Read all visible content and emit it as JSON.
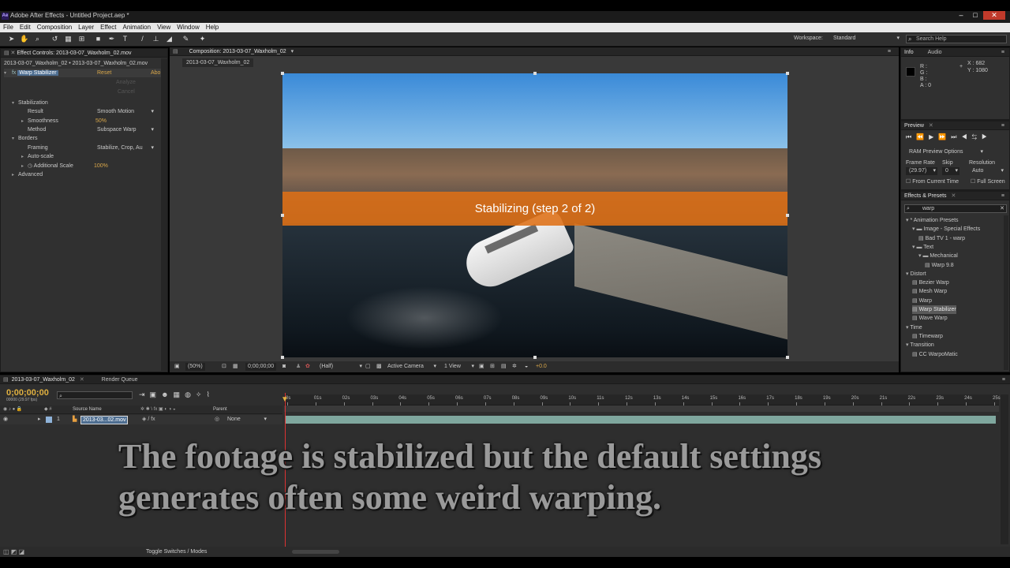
{
  "window": {
    "title": "Adobe After Effects - Untitled Project.aep *",
    "app_icon": "Ae"
  },
  "menu": [
    "File",
    "Edit",
    "Composition",
    "Layer",
    "Effect",
    "Animation",
    "View",
    "Window",
    "Help"
  ],
  "toolbar": {
    "workspace_label": "Workspace:",
    "workspace_value": "Standard",
    "search_placeholder": "Search Help"
  },
  "effect_controls": {
    "tab_label": "Effect Controls: 2013-03-07_Waxholm_02.mov",
    "layer_path": "2013-03-07_Waxholm_02 • 2013-03-07_Waxholm_02.mov",
    "effect_name": "Warp Stabilizer",
    "reset": "Reset",
    "about": "Abo",
    "analyze": "Analyze",
    "cancel": "Cancel",
    "rows": [
      {
        "label": "Stabilization",
        "indent": 0,
        "value": ""
      },
      {
        "label": "Result",
        "indent": 1,
        "value": "Smooth Motion",
        "kind": "dropdown"
      },
      {
        "label": "Smoothness",
        "indent": 1,
        "value": "50%",
        "kind": "number"
      },
      {
        "label": "Method",
        "indent": 1,
        "value": "Subspace Warp",
        "kind": "dropdown"
      },
      {
        "label": "Borders",
        "indent": 0,
        "value": ""
      },
      {
        "label": "Framing",
        "indent": 1,
        "value": "Stabilize, Crop, Au",
        "kind": "dropdown"
      },
      {
        "label": "Auto-scale",
        "indent": 1,
        "value": ""
      },
      {
        "label": "Additional Scale",
        "indent": 1,
        "value": "100%",
        "kind": "number"
      },
      {
        "label": "Advanced",
        "indent": 0,
        "value": ""
      }
    ]
  },
  "composition": {
    "tab_label": "Composition: 2013-03-07_Waxholm_02",
    "sub_tab": "2013-03-07_Waxholm_02",
    "overlay_text": "Stabilizing (step 2 of 2)",
    "footer": {
      "zoom": "(50%)",
      "timecode": "0;00;00;00",
      "resolution": "(Half)",
      "camera": "Active Camera",
      "views": "1 View",
      "exposure": "+0.0"
    }
  },
  "info": {
    "tabs": [
      "Info",
      "Audio"
    ],
    "r": "R :",
    "g": "G :",
    "b": "B :",
    "a": "A : 0",
    "x": "X : 682",
    "y": "Y : 1080"
  },
  "preview": {
    "tab": "Preview",
    "ram_options": "RAM Preview Options",
    "frame_rate_label": "Frame Rate",
    "skip_label": "Skip",
    "resolution_label": "Resolution",
    "frame_rate": "(29.97)",
    "skip": "0",
    "resolution": "Auto",
    "from_current": "From Current Time",
    "full_screen": "Full Screen"
  },
  "effects_presets": {
    "tab": "Effects & Presets",
    "search": "warp",
    "items": [
      {
        "label": "* Animation Presets",
        "level": 0,
        "type": "group"
      },
      {
        "label": "Image - Special Effects",
        "level": 1,
        "type": "folder"
      },
      {
        "label": "Bad TV 1 - warp",
        "level": 2,
        "type": "item"
      },
      {
        "label": "Text",
        "level": 1,
        "type": "folder"
      },
      {
        "label": "Mechanical",
        "level": 2,
        "type": "folder"
      },
      {
        "label": "Warp 9.8",
        "level": 3,
        "type": "item"
      },
      {
        "label": "Distort",
        "level": 0,
        "type": "group"
      },
      {
        "label": "Bezier Warp",
        "level": 1,
        "type": "item"
      },
      {
        "label": "Mesh Warp",
        "level": 1,
        "type": "item"
      },
      {
        "label": "Warp",
        "level": 1,
        "type": "item"
      },
      {
        "label": "Warp Stabilizer",
        "level": 1,
        "type": "item",
        "selected": true
      },
      {
        "label": "Wave Warp",
        "level": 1,
        "type": "item"
      },
      {
        "label": "Time",
        "level": 0,
        "type": "group"
      },
      {
        "label": "Timewarp",
        "level": 1,
        "type": "item"
      },
      {
        "label": "Transition",
        "level": 0,
        "type": "group"
      },
      {
        "label": "CC WarpoMatic",
        "level": 1,
        "type": "item"
      }
    ]
  },
  "timeline": {
    "tabs": [
      "2013-03-07_Waxholm_02",
      "Render Queue"
    ],
    "timecode": "0;00;00;00",
    "fps": "00000 (29.97 fps)",
    "col_source": "Source Name",
    "col_parent": "Parent",
    "layer_index": "1",
    "layer_name": "2013-03...02.mov",
    "parent_value": "None",
    "ruler": [
      "0s",
      "01s",
      "02s",
      "03s",
      "04s",
      "05s",
      "06s",
      "07s",
      "08s",
      "09s",
      "10s",
      "11s",
      "12s",
      "13s",
      "14s",
      "15s",
      "16s",
      "17s",
      "18s",
      "19s",
      "20s",
      "21s",
      "22s",
      "23s",
      "24s",
      "25s"
    ]
  },
  "status": {
    "toggle": "Toggle Switches / Modes"
  },
  "caption": {
    "line1": "The footage is stabilized but the default settings",
    "line2": "generates often some weird warping."
  }
}
